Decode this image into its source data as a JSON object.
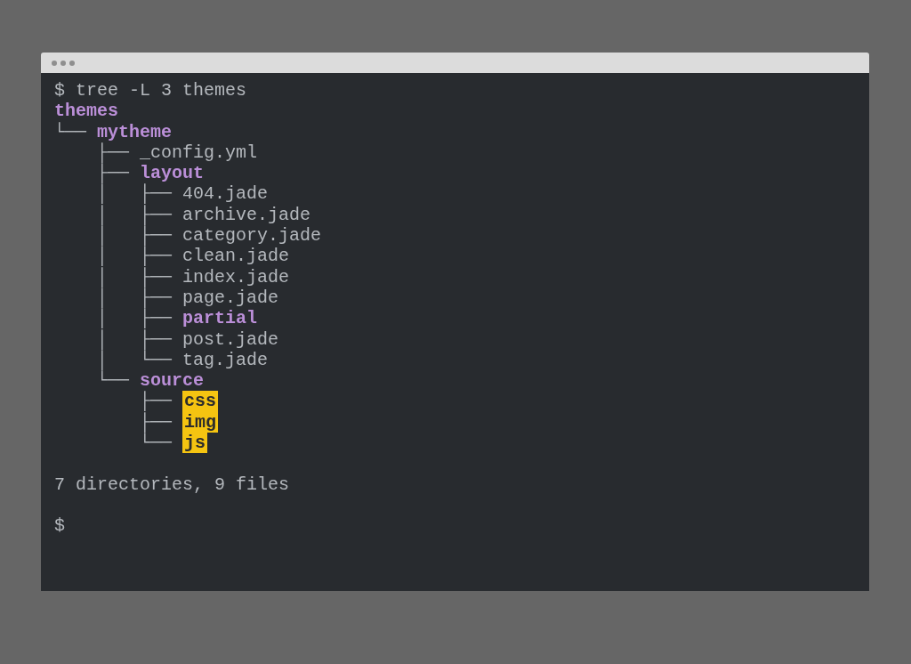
{
  "terminal": {
    "command_prompt": "$",
    "command": "tree -L 3 themes",
    "tree": {
      "name": "themes",
      "kind": "directory",
      "children": [
        {
          "branch": "└── ",
          "name": "mytheme",
          "kind": "directory",
          "children": [
            {
              "branch": "    ├── ",
              "name": "_config.yml",
              "kind": "file"
            },
            {
              "branch": "    ├── ",
              "name": "layout",
              "kind": "directory",
              "children": [
                {
                  "branch": "    │   ├── ",
                  "name": "404.jade",
                  "kind": "file"
                },
                {
                  "branch": "    │   ├── ",
                  "name": "archive.jade",
                  "kind": "file"
                },
                {
                  "branch": "    │   ├── ",
                  "name": "category.jade",
                  "kind": "file"
                },
                {
                  "branch": "    │   ├── ",
                  "name": "clean.jade",
                  "kind": "file"
                },
                {
                  "branch": "    │   ├── ",
                  "name": "index.jade",
                  "kind": "file"
                },
                {
                  "branch": "    │   ├── ",
                  "name": "page.jade",
                  "kind": "file"
                },
                {
                  "branch": "    │   ├── ",
                  "name": "partial",
                  "kind": "directory"
                },
                {
                  "branch": "    │   ├── ",
                  "name": "post.jade",
                  "kind": "file"
                },
                {
                  "branch": "    │   └── ",
                  "name": "tag.jade",
                  "kind": "file"
                }
              ]
            },
            {
              "branch": "    └── ",
              "name": "source",
              "kind": "directory",
              "children": [
                {
                  "branch": "        ├── ",
                  "name": "css",
                  "kind": "highlighted"
                },
                {
                  "branch": "        ├── ",
                  "name": "img",
                  "kind": "highlighted"
                },
                {
                  "branch": "        └── ",
                  "name": "js",
                  "kind": "highlighted"
                }
              ]
            }
          ]
        }
      ]
    },
    "summary": "7 directories, 9 files",
    "prompt": "$"
  }
}
